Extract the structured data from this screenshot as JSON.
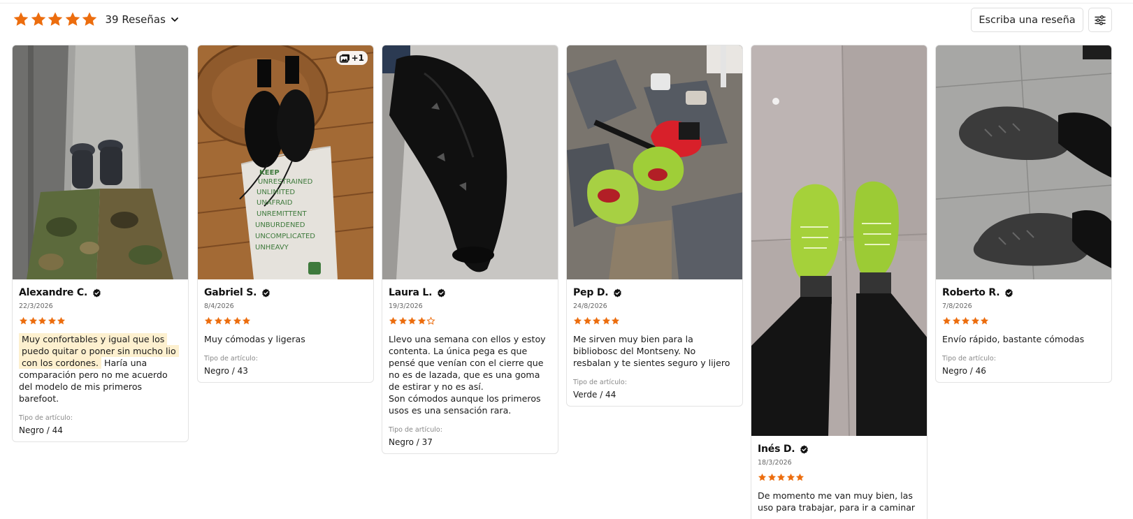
{
  "summary": {
    "rating_stars": 5,
    "count_label": "39 Reseñas",
    "write_review_label": "Escriba una reseña"
  },
  "colors": {
    "star": "#ec6d0e",
    "highlight": "#fdf0cf"
  },
  "icons": {
    "dropdown": "chevron-down-icon",
    "filter": "filter-sliders-icon",
    "verified": "verified-check-icon",
    "gallery": "gallery-icon"
  },
  "reviews": [
    {
      "name": "Alexandre C.",
      "date": "22/3/2026",
      "stars": 5,
      "text_highlight": "Muy confortables y igual que los puedo quitar o poner sin mucho lio con los cordones.",
      "text": "Haría una comparación pero no me acuerdo del modelo de mis primeros barefoot.",
      "variant_label": "Tipo de artículo:",
      "variant": "Negro / 44"
    },
    {
      "name": "Gabriel S.",
      "date": "8/4/2026",
      "stars": 5,
      "text": "Muy cómodas y ligeras",
      "variant_label": "Tipo de artículo:",
      "variant": "Negro / 43",
      "media_badge": "+1",
      "bag_text": [
        "KEEP",
        "UNRESTRAINED",
        "UNLIMITED",
        "UNAFRAID",
        "UNREMITTENT",
        "UNBURDENED",
        "UNCOMPLICATED",
        "UNHEAVY"
      ]
    },
    {
      "name": "Laura L.",
      "date": "19/3/2026",
      "stars": 4,
      "text": "Llevo una semana con ellos y estoy contenta. La única pega es que pensé que venían con el cierre que no es de lazada, que es una goma de estirar y no es así.\nSon cómodos aunque los primeros usos es una sensación rara.",
      "variant_label": "Tipo de artículo:",
      "variant": "Negro / 37"
    },
    {
      "name": "Pep D.",
      "date": "24/8/2026",
      "stars": 5,
      "text": "Me sirven muy bien para la bibliobosc del Montseny. No resbalan y te sientes seguro y lijero",
      "variant_label": "Tipo de artículo:",
      "variant": "Verde / 44"
    },
    {
      "name": "Inés D.",
      "date": "18/3/2026",
      "stars": 5,
      "text": "De momento me van muy bien, las uso para trabajar, para ir a caminar ."
    },
    {
      "name": "Roberto R.",
      "date": "7/8/2026",
      "stars": 5,
      "text": "Envío rápido, bastante cómodas",
      "variant_label": "Tipo de artículo:",
      "variant": "Negro / 46"
    }
  ]
}
